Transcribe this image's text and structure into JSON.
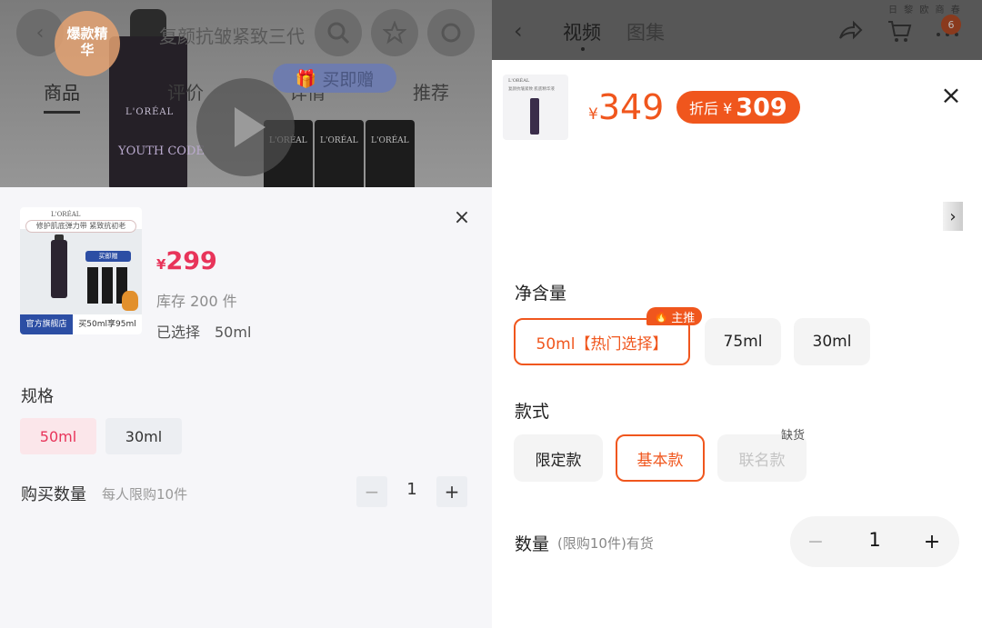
{
  "left": {
    "background": {
      "badge_text": "爆款精华",
      "title": "复颜抗皱紧致三代",
      "tabs": [
        "商品",
        "评价",
        "详情",
        "推荐"
      ],
      "gift_label": "买即赠",
      "bottle_brand": "L'ORÉAL",
      "bottle_name": "YOUTH CODE",
      "tube_brand": "L'ORÉAL"
    },
    "thumb": {
      "brand": "L'ORÉAL",
      "slogan": "修护肌底弹力带 紧致抗初老",
      "tag": "买即赠",
      "store": "官方旗舰店",
      "promo": "买50ml享95ml"
    },
    "price_currency": "¥",
    "price": "299",
    "stock": "库存 200 件",
    "selected": "已选择　50ml",
    "spec_label": "规格",
    "spec_options": [
      "50ml",
      "30ml"
    ],
    "qty_label": "购买数量",
    "qty_limit": "每人限购10件",
    "qty_minus": "−",
    "qty_value": "1",
    "qty_plus": "+",
    "close": "×"
  },
  "right": {
    "header": {
      "back": "‹",
      "tab_video": "视频",
      "tab_gallery": "图集",
      "menu_badge": "6",
      "status_text": "日 黎 欧 商 春"
    },
    "thumb": {
      "brand": "L'ORÉAL",
      "line": "复颜抗皱紧致 肌底精华液"
    },
    "price_currency": "¥",
    "price": "349",
    "discount_label": "折后 ¥",
    "discount_price": "309",
    "close": "×",
    "next_arrow": "›",
    "net_label": "净含量",
    "net_options": [
      "50ml【热门选择】",
      "75ml",
      "30ml"
    ],
    "recommend_badge": "主推",
    "style_label": "款式",
    "style_options": [
      "限定款",
      "基本款",
      "联名款"
    ],
    "out_of_stock": "缺货",
    "qty_label": "数量",
    "qty_note": "(限购10件)有货",
    "qty_minus": "−",
    "qty_value": "1",
    "qty_plus": "+"
  },
  "colors": {
    "left_accent": "#e8345a",
    "right_accent": "#f0561d"
  }
}
